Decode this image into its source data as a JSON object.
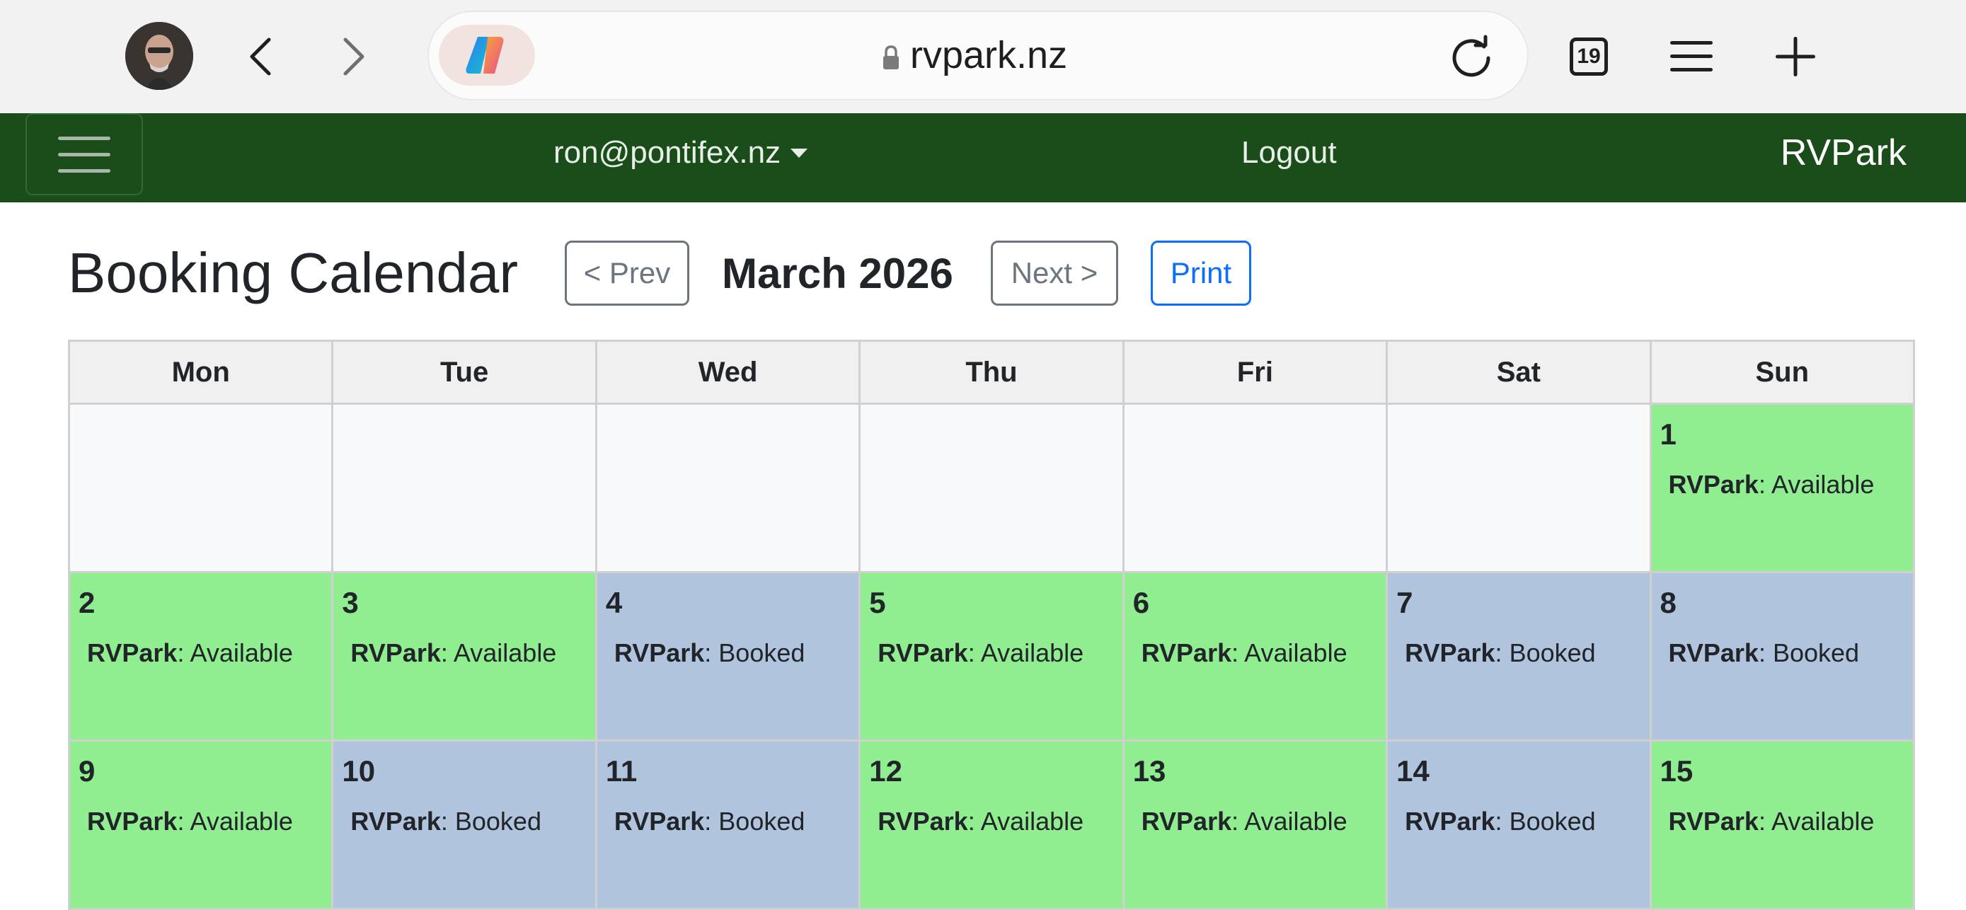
{
  "browser": {
    "url": "rvpark.nz",
    "tab_count": "19",
    "icons": {
      "avatar": "profile-photo",
      "back": "chevron-left-icon",
      "forward": "chevron-right-icon",
      "copilot": "copilot-logo-icon",
      "lock": "lock-icon",
      "reload": "reload-icon",
      "tabs": "tabs-icon",
      "menu": "hamburger-menu-icon",
      "new_tab": "plus-icon"
    }
  },
  "navbar": {
    "user": "ron@pontifex.nz",
    "logout": "Logout",
    "brand": "RVPark",
    "background": "#1b4d1b"
  },
  "page": {
    "title": "Booking Calendar",
    "prev_label": "< Prev",
    "month": "March 2026",
    "next_label": "Next >",
    "print_label": "Print"
  },
  "calendar": {
    "colors": {
      "available": "#90ee90",
      "booked": "#b0c4de",
      "empty": "#f8f9fa"
    },
    "weekdays": [
      "Mon",
      "Tue",
      "Wed",
      "Thu",
      "Fri",
      "Sat",
      "Sun"
    ],
    "weeks": [
      [
        {
          "empty": true
        },
        {
          "empty": true
        },
        {
          "empty": true
        },
        {
          "empty": true
        },
        {
          "empty": true
        },
        {
          "empty": true
        },
        {
          "day": "1",
          "site": "RVPark",
          "status": "Available"
        }
      ],
      [
        {
          "day": "2",
          "site": "RVPark",
          "status": "Available"
        },
        {
          "day": "3",
          "site": "RVPark",
          "status": "Available"
        },
        {
          "day": "4",
          "site": "RVPark",
          "status": "Booked"
        },
        {
          "day": "5",
          "site": "RVPark",
          "status": "Available"
        },
        {
          "day": "6",
          "site": "RVPark",
          "status": "Available"
        },
        {
          "day": "7",
          "site": "RVPark",
          "status": "Booked"
        },
        {
          "day": "8",
          "site": "RVPark",
          "status": "Booked"
        }
      ],
      [
        {
          "day": "9",
          "site": "RVPark",
          "status": "Available"
        },
        {
          "day": "10",
          "site": "RVPark",
          "status": "Booked"
        },
        {
          "day": "11",
          "site": "RVPark",
          "status": "Booked"
        },
        {
          "day": "12",
          "site": "RVPark",
          "status": "Available"
        },
        {
          "day": "13",
          "site": "RVPark",
          "status": "Available"
        },
        {
          "day": "14",
          "site": "RVPark",
          "status": "Booked"
        },
        {
          "day": "15",
          "site": "RVPark",
          "status": "Available"
        }
      ]
    ]
  }
}
